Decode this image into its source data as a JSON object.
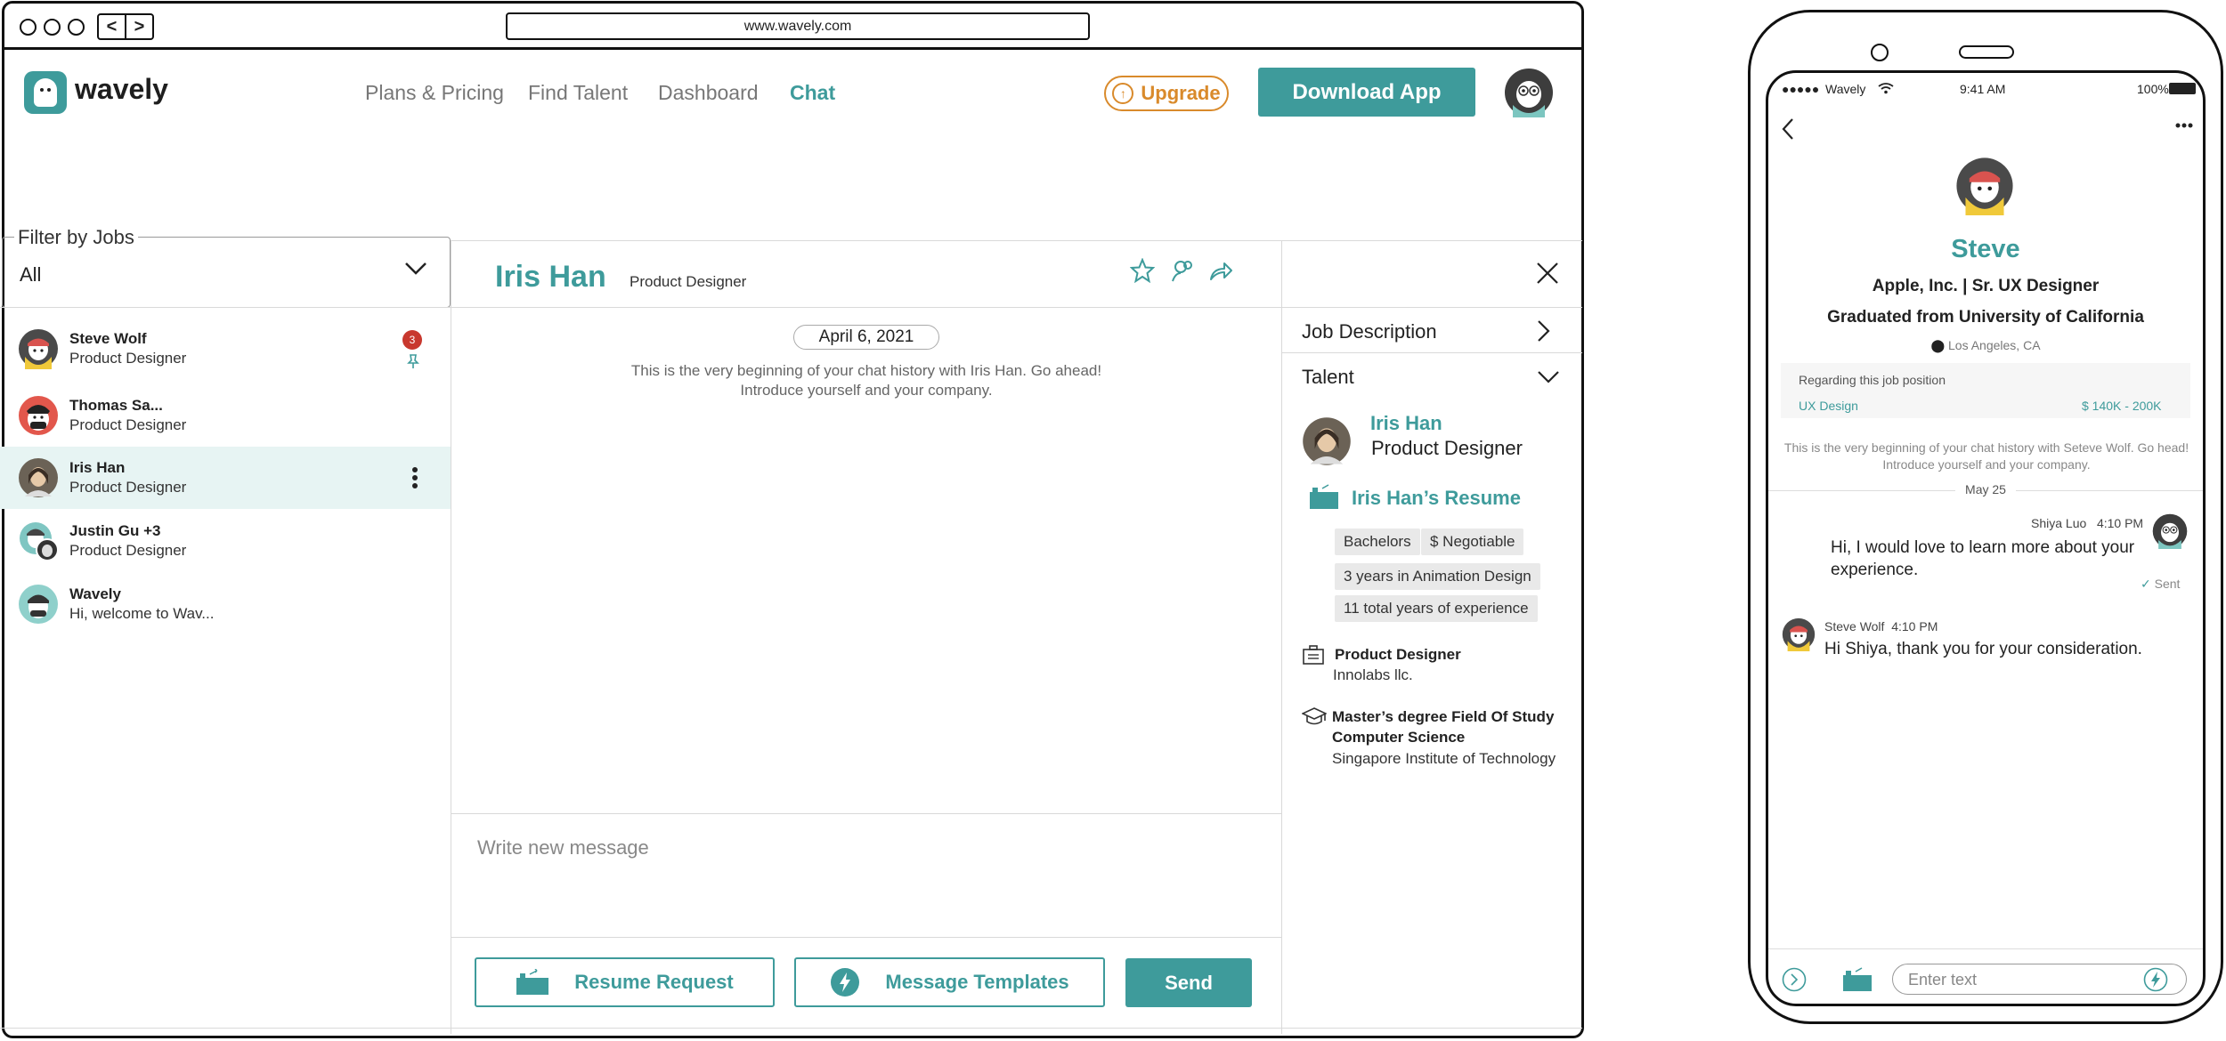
{
  "browser": {
    "url": "www.wavely.com"
  },
  "app": {
    "brand": "wavely",
    "nav": [
      "Plans & Pricing",
      "Find Talent",
      "Dashboard",
      "Chat"
    ],
    "active_nav": "Chat",
    "upgrade_label": "Upgrade",
    "download_label": "Download App",
    "accent_color": "#3e9b9b",
    "upgrade_color": "#d98a2b"
  },
  "filter": {
    "label": "Filter by Jobs",
    "value": "All"
  },
  "conversations": [
    {
      "name": "Steve Wolf",
      "sub": "Product Designer",
      "badge": "3",
      "pinned": true
    },
    {
      "name": "Thomas Sa...",
      "sub": "Product Designer"
    },
    {
      "name": "Iris Han",
      "sub": "Product Designer",
      "selected": true
    },
    {
      "name": "Justin Gu +3",
      "sub": "Product Designer"
    },
    {
      "name": "Wavely",
      "sub": "Hi, welcome to Wav..."
    }
  ],
  "chat": {
    "name": "Iris Han",
    "role": "Product Designer",
    "date": "April 6, 2021",
    "intro_line1": "This is the very beginning of your chat history with Iris Han. Go ahead!",
    "intro_line2": "Introduce yourself and your company.",
    "composer_placeholder": "Write new message",
    "resume_request": "Resume Request",
    "message_templates": "Message Templates",
    "send": "Send"
  },
  "side": {
    "job_description": "Job Description",
    "talent": "Talent",
    "talent_name": "Iris Han",
    "talent_role": "Product Designer",
    "resume_title": "Iris Han’s Resume",
    "tags": [
      "Bachelors",
      "$ Negotiable",
      "3 years in Animation Design",
      "11 total years of experience"
    ],
    "job_title": "Product Designer",
    "job_company": "Innolabs llc.",
    "edu_line1": "Master’s degree Field Of Study",
    "edu_line2": "Computer Science",
    "edu_school": "Singapore Institute of Technology"
  },
  "phone": {
    "carrier": "Wavely",
    "time": "9:41 AM",
    "battery": "100%",
    "name": "Steve",
    "company_line": "Apple, Inc. | Sr. UX Designer",
    "school": "Graduated from University of California",
    "location": "Los Angeles, CA",
    "regarding": "Regarding this job position",
    "job": "UX Design",
    "salary": "$ 140K - 200K",
    "intro_line1": "This is the very beginning of your chat history with Seteve Wolf. Go head!",
    "intro_line2": "Introduce yourself and your company.",
    "date": "May 25",
    "msg1_sender": "Shiya Luo",
    "msg1_time": "4:10 PM",
    "msg1_line1": "Hi, I would love to learn more about your",
    "msg1_line2": "experience.",
    "msg1_status": "Sent",
    "msg2_sender": "Steve Wolf",
    "msg2_time": "4:10 PM",
    "msg2_text": "Hi Shiya, thank you for your consideration.",
    "input_placeholder": "Enter text"
  }
}
